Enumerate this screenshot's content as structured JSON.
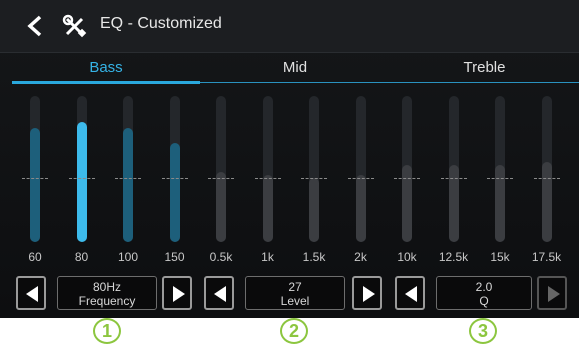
{
  "header": {
    "title": "EQ - Customized"
  },
  "tabs": [
    {
      "label": "Bass",
      "active": true
    },
    {
      "label": "Mid",
      "active": false
    },
    {
      "label": "Treble",
      "active": false
    }
  ],
  "bands": [
    {
      "label": "60",
      "level": 0.78,
      "state": "active"
    },
    {
      "label": "80",
      "level": 0.82,
      "state": "selected"
    },
    {
      "label": "100",
      "level": 0.78,
      "state": "active"
    },
    {
      "label": "150",
      "level": 0.68,
      "state": "active"
    },
    {
      "label": "0.5k",
      "level": 0.48,
      "state": "inactive"
    },
    {
      "label": "1k",
      "level": 0.46,
      "state": "inactive"
    },
    {
      "label": "1.5k",
      "level": 0.44,
      "state": "inactive"
    },
    {
      "label": "2k",
      "level": 0.46,
      "state": "inactive"
    },
    {
      "label": "10k",
      "level": 0.53,
      "state": "inactive"
    },
    {
      "label": "12.5k",
      "level": 0.53,
      "state": "inactive"
    },
    {
      "label": "15k",
      "level": 0.53,
      "state": "inactive"
    },
    {
      "label": "17.5k",
      "level": 0.55,
      "state": "inactive"
    }
  ],
  "controls": {
    "frequency": {
      "value": "80Hz",
      "label": "Frequency"
    },
    "level": {
      "value": "27",
      "label": "Level"
    },
    "q": {
      "value": "2.0",
      "label": "Q"
    }
  },
  "callouts": [
    "1",
    "2",
    "3"
  ],
  "colors": {
    "accent": "#35b3e6",
    "callout": "#8cc63f"
  }
}
